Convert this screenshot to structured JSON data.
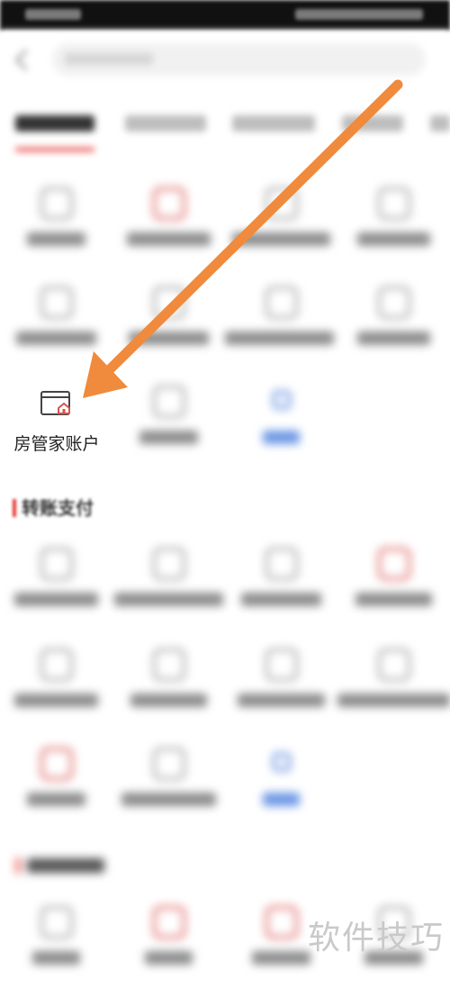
{
  "highlight_item": {
    "label": "房管家账户",
    "icon": "house-card-icon"
  },
  "section_transfer": {
    "title": "转账支付"
  },
  "watermark": {
    "text": "软件技巧"
  },
  "colors": {
    "arrow": "#f08a3c",
    "accent": "#e53935",
    "link": "#4a7bd8"
  }
}
